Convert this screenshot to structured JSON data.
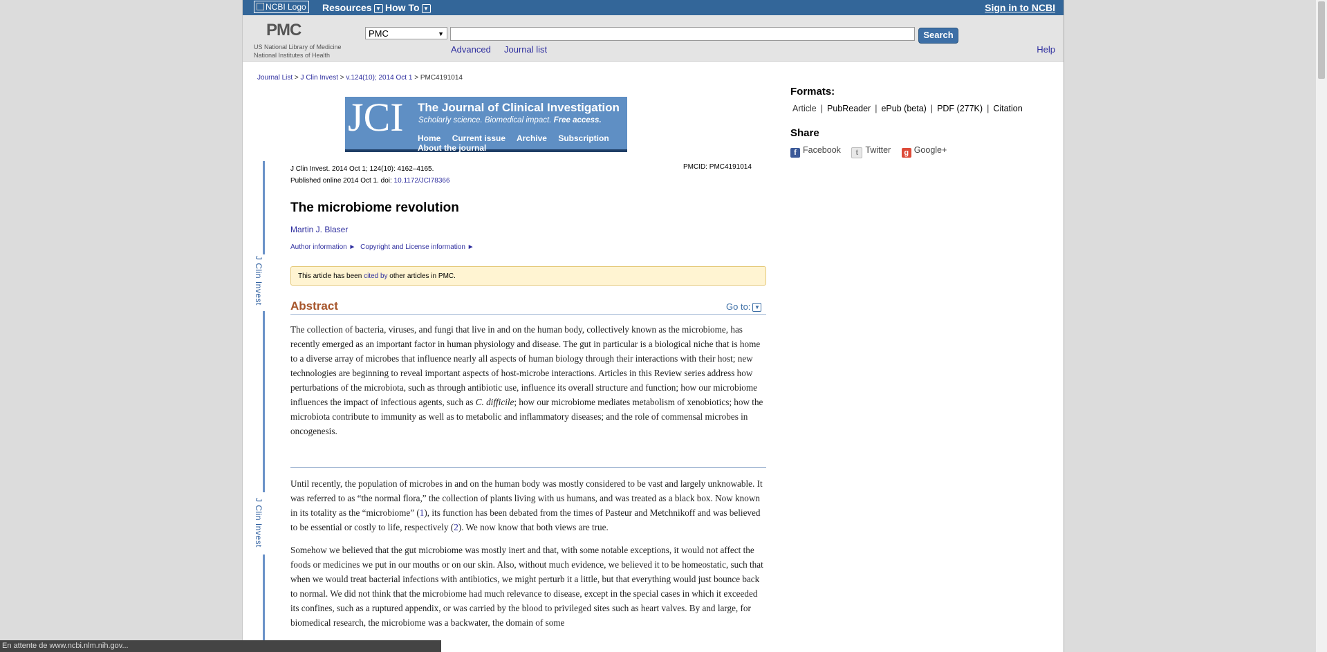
{
  "topbar": {
    "logo_alt": "NCBI Logo",
    "resources": "Resources",
    "howto": "How To",
    "signin": "Sign in to NCBI"
  },
  "pmc_header": {
    "logo": "PMC",
    "sub1": "US National Library of Medicine",
    "sub2": "National Institutes of Health",
    "db_selected": "PMC",
    "search_value": "",
    "search_button": "Search",
    "advanced": "Advanced",
    "journal_list": "Journal list",
    "help": "Help"
  },
  "breadcrumb": {
    "items": [
      "Journal List",
      "J Clin Invest",
      "v.124(10); 2014 Oct 1"
    ],
    "current": "PMC4191014",
    "sep": ">"
  },
  "jci_banner": {
    "logo": "JCI",
    "name": "The Journal of Clinical Investigation",
    "tagline_a": "Scholarly science. Biomedical impact. ",
    "tagline_b": "Free access.",
    "nav": [
      "Home",
      "Current issue",
      "Archive",
      "Subscription",
      "About the journal"
    ]
  },
  "ribbon_text": "J Clin Invest",
  "article": {
    "citation_line": "J Clin Invest. 2014 Oct 1; 124(10): 4162–4165.",
    "published_prefix": "Published online 2014 Oct 1. doi: ",
    "doi": "10.1172/JCI78366",
    "pmcid": "PMCID: PMC4191014",
    "title": "The microbiome revolution",
    "author": "Martin J. Blaser",
    "author_info": "Author information ►",
    "copyright_info": "Copyright and License information ►",
    "cited_prefix": "This article has been ",
    "cited_link": "cited by",
    "cited_suffix": " other articles in PMC.",
    "abstract_heading": "Abstract",
    "goto": "Go to:",
    "abstract_a": "The collection of bacteria, viruses, and fungi that live in and on the human body, collectively known as the microbiome, has recently emerged as an important factor in human physiology and disease. The gut in particular is a biological niche that is home to a diverse array of microbes that influence nearly all aspects of human biology through their interactions with their host; new technologies are beginning to reveal important aspects of host-microbe interactions. Articles in this Review series address how perturbations of the microbiota, such as through antibiotic use, influence its overall structure and function; how our microbiome influences the impact of infectious agents, such as ",
    "abstract_italic": "C. difficile",
    "abstract_b": "; how our microbiome mediates metabolism of xenobiotics; how the microbiota contribute to immunity as well as to metabolic and inflammatory diseases; and the role of commensal microbes in oncogenesis.",
    "p1_a": "Until recently, the population of microbes in and on the human body was mostly considered to be vast and largely unknowable. It was referred to as “the normal flora,” the collection of plants living with us humans, and was treated as a black box. Now known in its totality as the “microbiome” (",
    "p1_ref1": "1",
    "p1_b": "), its function has been debated from the times of Pasteur and Metchnikoff and was believed to be essential or costly to life, respectively (",
    "p1_ref2": "2",
    "p1_c": "). We now know that both views are true.",
    "p2": "Somehow we believed that the gut microbiome was mostly inert and that, with some notable exceptions, it would not affect the foods or medicines we put in our mouths or on our skin. Also, without much evidence, we believed it to be homeostatic, such that when we would treat bacterial infections with antibiotics, we might perturb it a little, but that everything would just bounce back to normal. We did not think that the microbiome had much relevance to disease, except in the special cases in which it exceeded its confines, such as a ruptured appendix, or was carried by the blood to privileged sites such as heart valves. By and large, for biomedical research, the microbiome was a backwater, the domain of some"
  },
  "sidebar": {
    "formats_heading": "Formats:",
    "formats": [
      "Article",
      "PubReader",
      "ePub (beta)",
      "PDF (277K)",
      "Citation"
    ],
    "share_heading": "Share",
    "share": [
      "Facebook",
      "Twitter",
      "Google+"
    ]
  },
  "status_text": "En attente de www.ncbi.nlm.nih.gov...",
  "colors": {
    "ncbi_blue": "#336699",
    "abstract_heading": "#a6552b",
    "cited_box": "#fff4d2"
  }
}
